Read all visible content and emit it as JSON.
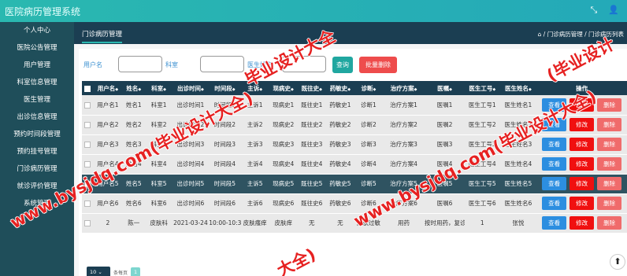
{
  "app": {
    "title": "医院病历管理系统"
  },
  "topbar": {
    "icons": [
      "expand-icon",
      "user-icon"
    ],
    "expand_glyph": "⤡",
    "user_glyph": "👤"
  },
  "sidebar": {
    "items": [
      "个人中心",
      "医院公告管理",
      "用户管理",
      "科室信息管理",
      "医生管理",
      "出诊信息管理",
      "预约时间段管理",
      "预约挂号管理",
      "门诊病历管理",
      "就诊评价管理",
      "系统管理"
    ]
  },
  "tab": {
    "label": "门诊病历管理"
  },
  "breadcrumb": {
    "text": "⌂ / 门诊病历管理 / 门诊病历列表"
  },
  "search": {
    "username_label": "用户名",
    "dept_label": "科室",
    "doctor_label": "医生姓名",
    "search_button": "查询",
    "batch_delete_button": "批量删除"
  },
  "table": {
    "headers": [
      "用户名",
      "姓名",
      "科室",
      "出诊时间",
      "时间段",
      "主诉",
      "现病史",
      "既往史",
      "药敏史",
      "诊断",
      "治疗方案",
      "医嘱",
      "医生工号",
      "医生姓名",
      "操作"
    ],
    "sort_mark": "◆",
    "rows": [
      [
        "用户名1",
        "姓名1",
        "科室1",
        "出诊时间1",
        "时间段1",
        "主诉1",
        "现病史1",
        "既往史1",
        "药敏史1",
        "诊断1",
        "治疗方案1",
        "医嘱1",
        "医生工号1",
        "医生姓名1"
      ],
      [
        "用户名2",
        "姓名2",
        "科室2",
        "出诊时间2",
        "时间段2",
        "主诉2",
        "现病史2",
        "既往史2",
        "药敏史2",
        "诊断2",
        "治疗方案2",
        "医嘱2",
        "医生工号2",
        "医生姓名2"
      ],
      [
        "用户名3",
        "姓名3",
        "科室3",
        "出诊时间3",
        "时间段3",
        "主诉3",
        "现病史3",
        "既往史3",
        "药敏史3",
        "诊断3",
        "治疗方案3",
        "医嘱3",
        "医生工号3",
        "医生姓名3"
      ],
      [
        "用户名4",
        "姓名4",
        "科室4",
        "出诊时间4",
        "时间段4",
        "主诉4",
        "现病史4",
        "既往史4",
        "药敏史4",
        "诊断4",
        "治疗方案4",
        "医嘱4",
        "医生工号4",
        "医生姓名4"
      ],
      [
        "用户名5",
        "姓名5",
        "科室5",
        "出诊时间5",
        "时间段5",
        "主诉5",
        "现病史5",
        "既往史5",
        "药敏史5",
        "诊断5",
        "治疗方案5",
        "医嘱5",
        "医生工号5",
        "医生姓名5"
      ],
      [
        "用户名6",
        "姓名6",
        "科室6",
        "出诊时间6",
        "时间段6",
        "主诉6",
        "现病史6",
        "既往史6",
        "药敏史6",
        "诊断6",
        "治疗方案6",
        "医嘱6",
        "医生工号6",
        "医生姓名6"
      ],
      [
        "2",
        "陈一",
        "皮肤科",
        "2021-03-24",
        "10:00-10:30",
        "皮肤瘙痒",
        "皮肤痒",
        "无",
        "无",
        "皮肤过敏",
        "用药",
        "按时用药，复诊",
        "1",
        "张悦"
      ]
    ],
    "selected_row_index": 4,
    "actions": {
      "view": "查看",
      "edit": "修改",
      "delete": "删除"
    }
  },
  "pager": {
    "page_size": "10",
    "per_page_label": "条每页",
    "current_page": "1"
  },
  "watermarks": [
    {
      "text": "毕业设计大全"
    },
    {
      "text": "www.bysjdq.com(毕业设计大全)"
    },
    {
      "text": "www.bysjdq.com(毕业设计大全)"
    },
    {
      "text": "(毕业设计"
    },
    {
      "text": "大全)"
    }
  ],
  "colors": {
    "topbar": "#2ab8b0",
    "sidebar": "#1f4e5a",
    "header": "#1b3e52",
    "view": "#2c8ee0",
    "edit": "#f01010",
    "delete": "#f06b6b",
    "search": "#20a7a0",
    "batch_delete": "#ee4c4c"
  }
}
